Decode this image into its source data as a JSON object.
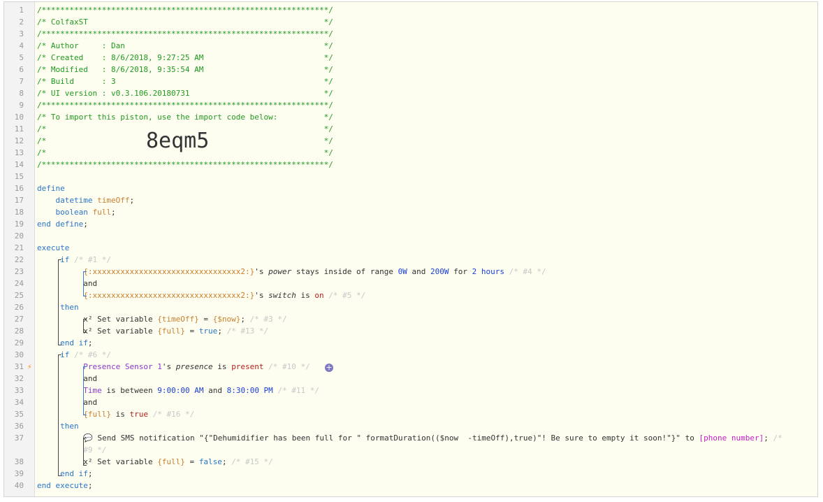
{
  "lines": [
    {
      "n": "1",
      "html": "<span class='cm'>/**************************************************************/</span>"
    },
    {
      "n": "2",
      "html": "<span class='cm'>/* ColfaxST                                                   */</span>"
    },
    {
      "n": "3",
      "html": "<span class='cm'>/**************************************************************/</span>"
    },
    {
      "n": "4",
      "html": "<span class='cm'>/* Author     : Dan                                           */</span>"
    },
    {
      "n": "5",
      "html": "<span class='cm'>/* Created    : 8/6/2018, 9:27:25 AM                          */</span>"
    },
    {
      "n": "6",
      "html": "<span class='cm'>/* Modified   : 8/6/2018, 9:35:54 AM                          */</span>"
    },
    {
      "n": "7",
      "html": "<span class='cm'>/* Build      : 3                                             */</span>"
    },
    {
      "n": "8",
      "html": "<span class='cm'>/* UI version : v0.3.106.20180731                             */</span>"
    },
    {
      "n": "9",
      "html": "<span class='cm'>/**************************************************************/</span>"
    },
    {
      "n": "10",
      "html": "<span class='cm'>/* To import this piston, use the import code below:          */</span>"
    },
    {
      "n": "11",
      "html": "<span class='cm'>/*                                                            */</span>"
    },
    {
      "n": "12",
      "html": "<span class='cm'>/*                                                            */</span>"
    },
    {
      "n": "13",
      "html": "<span class='cm'>/*                                                            */</span>"
    },
    {
      "n": "14",
      "html": "<span class='cm'>/**************************************************************/</span>"
    },
    {
      "n": "15",
      "html": ""
    },
    {
      "n": "16",
      "html": "<span class='kw'>define</span>"
    },
    {
      "n": "17",
      "html": "    <span class='kw'>datetime</span> <span class='var'>timeOff</span>;"
    },
    {
      "n": "18",
      "html": "    <span class='kw'>boolean</span> <span class='var'>full</span>;"
    },
    {
      "n": "19",
      "html": "<span class='kw'>end define</span>;"
    },
    {
      "n": "20",
      "html": ""
    },
    {
      "n": "21",
      "html": "<span class='kw'>execute</span>"
    },
    {
      "n": "22",
      "html": "     <span class='kw'>if</span> <span class='fade'>/* #1 */</span>"
    },
    {
      "n": "23",
      "html": "          <span class='dev'>{:xxxxxxxxxxxxxxxxxxxxxxxxxxxxxxxx2:}</span>'s <span class='ital'>power</span> stays inside of range <span class='num2'>0W</span> and <span class='num2'>200W</span> for <span class='num2'>2 hours</span> <span class='fade'>/* #4 */</span>"
    },
    {
      "n": "24",
      "html": "          and"
    },
    {
      "n": "25",
      "html": "          <span class='dev'>{:xxxxxxxxxxxxxxxxxxxxxxxxxxxxxxxx2:}</span>'s <span class='ital'>switch</span> is <span class='red'>on</span> <span class='fade'>/* #5 */</span>"
    },
    {
      "n": "26",
      "html": "     <span class='kw'>then</span>"
    },
    {
      "n": "27",
      "html": "          x² Set variable <span class='var'>{timeOff}</span> = <span class='var'>{$now}</span>; <span class='fade'>/* #3 */</span>"
    },
    {
      "n": "28",
      "html": "          x² Set variable <span class='var'>{full}</span> = <span class='kw'>true</span>; <span class='fade'>/* #13 */</span>"
    },
    {
      "n": "29",
      "html": "     <span class='kw'>end if</span>;"
    },
    {
      "n": "30",
      "html": "     <span class='kw'>if</span> <span class='fade'>/* #6 */</span>"
    },
    {
      "n": "31",
      "html": "          <span class='purp'>Presence Sensor 1</span>'s <span class='ital'>presence</span> is <span class='red'>present</span> <span class='fade'>/* #10 */</span>"
    },
    {
      "n": "32",
      "html": "          and"
    },
    {
      "n": "33",
      "html": "          <span class='purp'>Time</span> is between <span class='num2'>9:00:00 AM</span> and <span class='num2'>8:30:00 PM</span> <span class='fade'>/* #11 */</span>"
    },
    {
      "n": "34",
      "html": "          and"
    },
    {
      "n": "35",
      "html": "          <span class='var'>{full}</span> is <span class='red'>true</span> <span class='fade'>/* #16 */</span>"
    },
    {
      "n": "36",
      "html": "     <span class='kw'>then</span>"
    },
    {
      "n": "37",
      "html": "          💬 Send SMS notification \"{\"Dehumidifier has been full for \" formatDuration(($now  -timeOff),true)\"! Be sure to empty it soon!\"}\" to <span class='mag'>[phone number]</span>; <span class='fade'>/*</span>"
    },
    {
      "n": "",
      "html": "          <span class='fade'>#9 */</span>"
    },
    {
      "n": "38",
      "html": "          x² Set variable <span class='var'>{full}</span> = <span class='kw'>false</span>; <span class='fade'>/* #15 */</span>"
    },
    {
      "n": "39",
      "html": "     <span class='kw'>end if</span>;"
    },
    {
      "n": "40",
      "html": "<span class='kw'>end execute</span>;"
    }
  ],
  "import_code": "8eqm5",
  "colors": {
    "comment": "#1f9a1f",
    "keyword": "#2a75c9",
    "variable": "#c87f2e",
    "bracket": "#3b7bd4"
  }
}
